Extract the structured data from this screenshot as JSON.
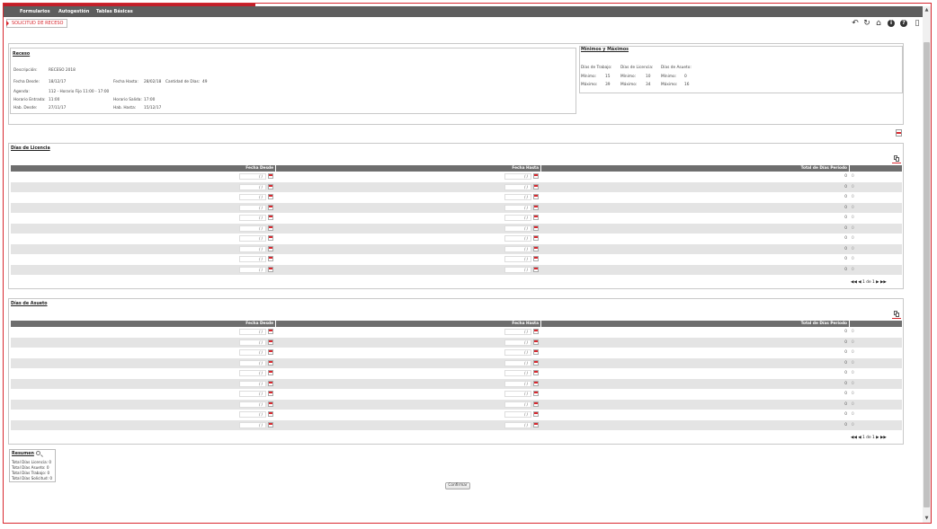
{
  "menu": [
    "Formularios",
    "Autogestión",
    "Tablas Básicas"
  ],
  "page_title": "SOLICITUD DE RECESO",
  "receso": {
    "title": "Receso",
    "descripcion_label": "Descripción:",
    "descripcion": "RECESO 2018",
    "fecha_desde_label": "Fecha Desde:",
    "fecha_desde": "18/12/17",
    "fecha_hasta_label": "Fecha Hasta:",
    "fecha_hasta": "28/02/18",
    "cantidad_label": "Cantidad de Días:",
    "cantidad": "49",
    "agenda_label": "Agenda:",
    "agenda": "112 - Horario Fijo 11:00 - 17:00",
    "entrada_label": "Horario Entrada:",
    "entrada": "11:00",
    "salida_label": "Horario Salida:",
    "salida": "17:00",
    "hab_desde_label": "Hab. Desde:",
    "hab_desde": "27/11/17",
    "hab_hasta_label": "Hab. Hasta:",
    "hab_hasta": "15/12/17"
  },
  "minmax": {
    "title": "Mínimos y Máximos",
    "col_trabajo": "Días de Trabajo:",
    "col_licencia": "Días de Licencia:",
    "col_asueto": "Días de Asueto:",
    "min_label": "Mínimo:",
    "max_label": "Máximo:",
    "trabajo_min": "15",
    "trabajo_max": "39",
    "licencia_min": "10",
    "licencia_max": "34",
    "asueto_min": "0",
    "asueto_max": "16"
  },
  "licencia": {
    "title": "Días de Licencia",
    "headers": [
      "Fecha Desde",
      "Fecha Hasta",
      "Total de Días Período"
    ],
    "rows": [
      {
        "desde": "/ /",
        "hasta": "/ /",
        "total": "0",
        "extra": "0"
      },
      {
        "desde": "/ /",
        "hasta": "/ /",
        "total": "0",
        "extra": "0"
      },
      {
        "desde": "/ /",
        "hasta": "/ /",
        "total": "0",
        "extra": "0"
      },
      {
        "desde": "/ /",
        "hasta": "/ /",
        "total": "0",
        "extra": "0"
      },
      {
        "desde": "/ /",
        "hasta": "/ /",
        "total": "0",
        "extra": "0"
      },
      {
        "desde": "/ /",
        "hasta": "/ /",
        "total": "0",
        "extra": "0"
      },
      {
        "desde": "/ /",
        "hasta": "/ /",
        "total": "0",
        "extra": "0"
      },
      {
        "desde": "/ /",
        "hasta": "/ /",
        "total": "0",
        "extra": "0"
      },
      {
        "desde": "/ /",
        "hasta": "/ /",
        "total": "0",
        "extra": "0"
      },
      {
        "desde": "/ /",
        "hasta": "/ /",
        "total": "0",
        "extra": "0"
      }
    ],
    "pager": "1 de 1"
  },
  "asueto": {
    "title": "Días de Asueto",
    "headers": [
      "Fecha Desde",
      "Fecha Hasta",
      "Total de Días Período"
    ],
    "rows": [
      {
        "desde": "/ /",
        "hasta": "/ /",
        "total": "0",
        "extra": "0"
      },
      {
        "desde": "/ /",
        "hasta": "/ /",
        "total": "0",
        "extra": "0"
      },
      {
        "desde": "/ /",
        "hasta": "/ /",
        "total": "0",
        "extra": "0"
      },
      {
        "desde": "/ /",
        "hasta": "/ /",
        "total": "0",
        "extra": "0"
      },
      {
        "desde": "/ /",
        "hasta": "/ /",
        "total": "0",
        "extra": "0"
      },
      {
        "desde": "/ /",
        "hasta": "/ /",
        "total": "0",
        "extra": "0"
      },
      {
        "desde": "/ /",
        "hasta": "/ /",
        "total": "0",
        "extra": "0"
      },
      {
        "desde": "/ /",
        "hasta": "/ /",
        "total": "0",
        "extra": "0"
      },
      {
        "desde": "/ /",
        "hasta": "/ /",
        "total": "0",
        "extra": "0"
      },
      {
        "desde": "/ /",
        "hasta": "/ /",
        "total": "0",
        "extra": "0"
      }
    ],
    "pager": "1 de 1"
  },
  "resumen": {
    "title": "Resumen",
    "lic_label": "Total Días Licencia:",
    "lic": "0",
    "asu_label": "Total Días Asueto:",
    "asu": "0",
    "tra_label": "Total Días Trabajo:",
    "tra": "0",
    "sol_label": "Total Días Solicitud:",
    "sol": "0"
  },
  "confirm_label": "Confirmar",
  "icons": {
    "toolbar": [
      "undo-icon",
      "refresh-icon",
      "home-icon",
      "info-icon",
      "help-icon",
      "exit-icon"
    ],
    "pdf": "pdf-icon",
    "copy": "copy-icon",
    "calendar": "calendar-icon",
    "search": "magnifier-icon"
  },
  "colors": {
    "accent": "#d8282f",
    "menu_bg": "#5e5e5e",
    "grid_header": "#6e6e6e",
    "row_alt": "#e4e4e4"
  }
}
